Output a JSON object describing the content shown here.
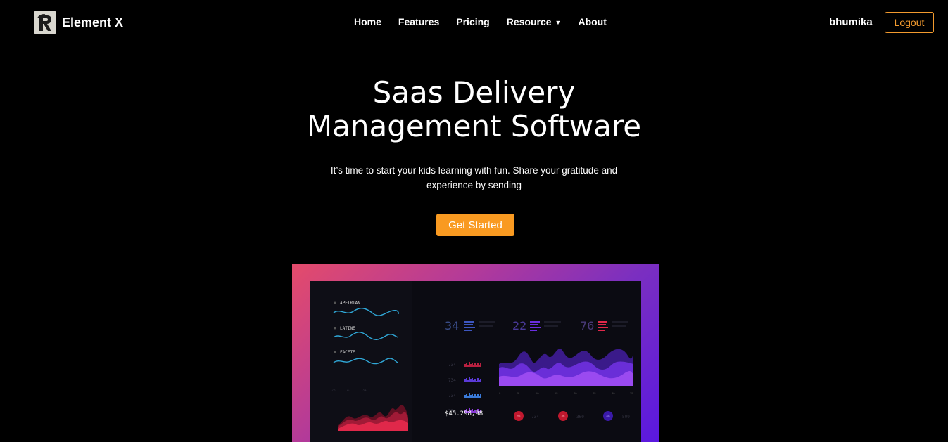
{
  "brand": {
    "name": "Element X",
    "logo_icon": "r-letter-logo-icon"
  },
  "nav": {
    "home": "Home",
    "features": "Features",
    "pricing": "Pricing",
    "resource": "Resource",
    "about": "About"
  },
  "user": {
    "name": "bhumika",
    "logout_label": "Logout"
  },
  "hero": {
    "title_line1": "Saas Delivery",
    "title_line2": "Management Software",
    "subtitle": "It’s time to start your kids learning with fun. Share your gratitude and experience by sending",
    "cta_label": "Get Started"
  },
  "dashboard": {
    "left_labels": [
      "APEIRIAN",
      "LATINE",
      "FACETE"
    ],
    "stats": [
      "34",
      "22",
      "76"
    ],
    "list_values": [
      "734",
      "734",
      "734",
      "734"
    ],
    "axis_ticks": [
      "0",
      "5",
      "10",
      "15",
      "20",
      "25",
      "30",
      "35"
    ],
    "total": "$45.298,98",
    "badges": [
      {
        "value": "25",
        "reading": "734"
      },
      {
        "value": "45",
        "reading": "360"
      },
      {
        "value": "69",
        "reading": "509"
      }
    ]
  },
  "colors": {
    "accent": "#f99a21",
    "frame_start": "#e44b6b",
    "frame_end": "#5a18e0"
  }
}
